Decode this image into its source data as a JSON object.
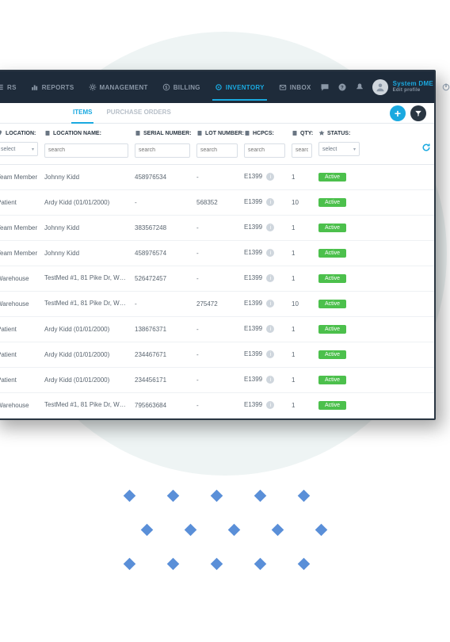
{
  "nav": {
    "items": [
      {
        "label": "RS"
      },
      {
        "label": "REPORTS"
      },
      {
        "label": "MANAGEMENT"
      },
      {
        "label": "BILLING"
      },
      {
        "label": "INVENTORY",
        "active": true
      },
      {
        "label": "INBOX"
      }
    ]
  },
  "user": {
    "name": "System DME",
    "sub": "Edit profile"
  },
  "subtabs": {
    "items": "ITEMS",
    "purchase_orders": "PURCHASE ORDERS"
  },
  "columns": {
    "location": "LOCATION:",
    "location_name": "LOCATION NAME:",
    "serial": "SERIAL NUMBER:",
    "lot": "LOT NUMBER:",
    "hcpcs": "HCPCS:",
    "qty": "QTY:",
    "status": "STATUS:"
  },
  "filters": {
    "select": "select",
    "search": "search"
  },
  "rows": [
    {
      "location": "Team Member",
      "location_name": "Johnny Kidd",
      "serial": "458976534",
      "lot": "-",
      "hcpcs": "E1399",
      "qty": "1",
      "status": "Active"
    },
    {
      "location": "Patient",
      "location_name": "Ardy Kidd (01/01/2000)",
      "serial": "-",
      "lot": "568352",
      "hcpcs": "E1399",
      "qty": "10",
      "status": "Active"
    },
    {
      "location": "Team Member",
      "location_name": "Johnny Kidd",
      "serial": "383567248",
      "lot": "-",
      "hcpcs": "E1399",
      "qty": "1",
      "status": "Active"
    },
    {
      "location": "Team Member",
      "location_name": "Johnny Kidd",
      "serial": "458976574",
      "lot": "-",
      "hcpcs": "E1399",
      "qty": "1",
      "status": "Active"
    },
    {
      "location": "Warehouse",
      "location_name": "TestMed #1, 81 Pike Dr, W…",
      "info": true,
      "serial": "526472457",
      "lot": "-",
      "hcpcs": "E1399",
      "qty": "1",
      "status": "Active"
    },
    {
      "location": "Warehouse",
      "location_name": "TestMed #1, 81 Pike Dr, W…",
      "info": true,
      "serial": "-",
      "lot": "275472",
      "hcpcs": "E1399",
      "qty": "10",
      "status": "Active"
    },
    {
      "location": "Patient",
      "location_name": "Ardy Kidd (01/01/2000)",
      "serial": "138676371",
      "lot": "-",
      "hcpcs": "E1399",
      "qty": "1",
      "status": "Active"
    },
    {
      "location": "Patient",
      "location_name": "Ardy Kidd (01/01/2000)",
      "serial": "234467671",
      "lot": "-",
      "hcpcs": "E1399",
      "qty": "1",
      "status": "Active"
    },
    {
      "location": "Patient",
      "location_name": "Ardy Kidd (01/01/2000)",
      "serial": "234456171",
      "lot": "-",
      "hcpcs": "E1399",
      "qty": "1",
      "status": "Active"
    },
    {
      "location": "Warehouse",
      "location_name": "TestMed #1, 81 Pike Dr, W…",
      "info": true,
      "serial": "795663684",
      "lot": "-",
      "hcpcs": "E1399",
      "qty": "1",
      "status": "Active"
    }
  ]
}
